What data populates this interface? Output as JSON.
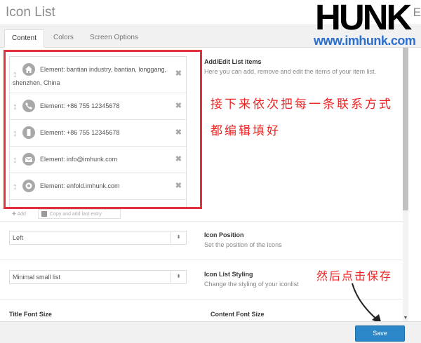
{
  "window": {
    "title": "Icon List",
    "edge_letter": "E"
  },
  "watermark": {
    "brand": "HUNK",
    "url": "www.imhunk.com"
  },
  "tabs": [
    {
      "label": "Content",
      "active": true
    },
    {
      "label": "Colors",
      "active": false
    },
    {
      "label": "Screen Options",
      "active": false
    }
  ],
  "list_items": [
    {
      "icon": "home-icon",
      "text": "Element: bantian industry, bantian, longgang, shenzhen, China"
    },
    {
      "icon": "phone-icon",
      "text": "Element: +86 755 12345678"
    },
    {
      "icon": "mobile-icon",
      "text": "Element: +86 755 12345678"
    },
    {
      "icon": "mail-icon",
      "text": "Element: info@imhunk.com"
    },
    {
      "icon": "web-icon",
      "text": "Element: enfold.imhunk.com"
    }
  ],
  "list_actions": {
    "add": "Add",
    "copy": "Copy and add last entry"
  },
  "fields": {
    "list_items": {
      "label": "Add/Edit List items",
      "desc": "Here you can add, remove and edit the items of your item list."
    },
    "icon_position": {
      "label": "Icon Position",
      "desc": "Set the position of the icons",
      "value": "Left"
    },
    "icon_list_styling": {
      "label": "Icon List Styling",
      "desc": "Change the styling of your iconlist",
      "value": "Minimal small list"
    },
    "title_font_size": {
      "label": "Title Font Size"
    },
    "content_font_size": {
      "label": "Content Font Size"
    }
  },
  "annotations": {
    "line1": "接下来依次把每一条联系方式",
    "line2": "都编辑填好",
    "save_hint": "然后点击保存"
  },
  "footer": {
    "save_label": "Save"
  },
  "colors": {
    "annotation": "#e2313a",
    "save_button": "#2b87c7",
    "watermark_url": "#2b6fd0"
  }
}
